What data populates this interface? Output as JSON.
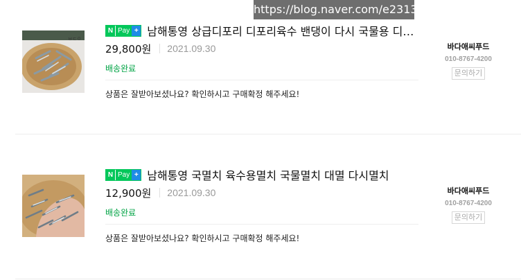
{
  "watermark": "https://blog.naver.com/e2313",
  "npay_badge": {
    "n": "N",
    "pay": "Pay",
    "plus": "+"
  },
  "orders": [
    {
      "title": "남해통영 상급디포리 디포리육수 밴댕이 다시 국물용 디포리",
      "price": "29,800원",
      "date": "2021.09.30",
      "status": "배송완료",
      "message": "상품은 잘받아보셨나요? 확인하시고 구매확정 해주세요!",
      "seller": {
        "name": "바다애씨푸드",
        "phone": "010-8767-4200",
        "inquiry_label": "문의하기"
      }
    },
    {
      "title": "남해통영 국멸치 육수용멸치 국물멸치 대멸 다시멸치",
      "price": "12,900원",
      "date": "2021.09.30",
      "status": "배송완료",
      "message": "상품은 잘받아보셨나요? 확인하시고 구매확정 해주세요!",
      "seller": {
        "name": "바다애씨푸드",
        "phone": "010-8767-4200",
        "inquiry_label": "문의하기"
      }
    }
  ],
  "colors": {
    "status_green": "#00a344",
    "npay_green": "#03c75a",
    "npay_blue": "#1f8ce6"
  }
}
